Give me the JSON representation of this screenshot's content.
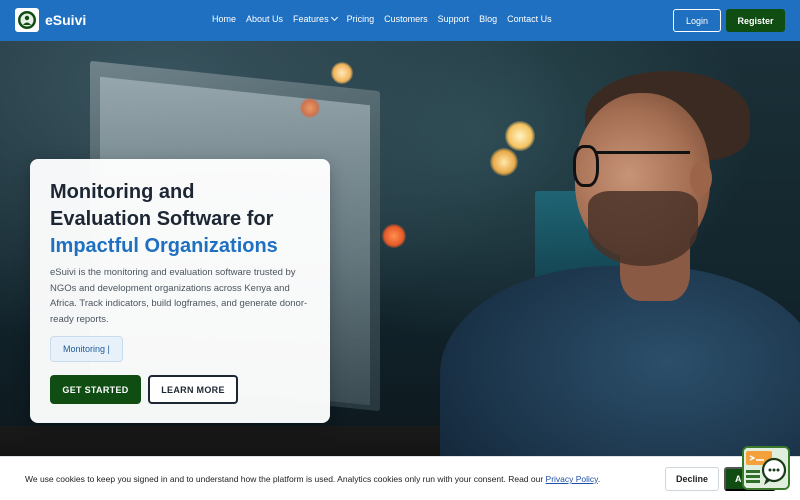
{
  "brand": {
    "name": "eSuivi"
  },
  "nav": {
    "items": [
      {
        "label": "Home"
      },
      {
        "label": "About Us"
      },
      {
        "label": "Features",
        "has_dropdown": true
      },
      {
        "label": "Pricing"
      },
      {
        "label": "Customers"
      },
      {
        "label": "Support"
      },
      {
        "label": "Blog"
      },
      {
        "label": "Contact Us"
      }
    ],
    "login_label": "Login",
    "register_label": "Register"
  },
  "hero": {
    "title_line1": "Monitoring and",
    "title_line2": "Evaluation Software for",
    "title_highlight": "Impactful Organizations",
    "description": "eSuivi is the monitoring and evaluation software trusted by NGOs and development organizations across Kenya and Africa. Track indicators, build logframes, and generate donor-ready reports.",
    "typing_text": "Monitoring |",
    "cta_primary": "GET STARTED",
    "cta_secondary": "LEARN MORE"
  },
  "cookie": {
    "text": "We use cookies to keep you signed in and to understand how the platform is used. Analytics cookies only run with your consent. Read our ",
    "link_text": "Privacy Policy",
    "suffix": ".",
    "decline_label": "Decline",
    "accept_label": "Accept"
  },
  "colors": {
    "primary": "#1f70c1",
    "cta_green": "#0f4d13",
    "heading": "#1d2733"
  },
  "icons": {
    "logo": "esuivi-logo-icon",
    "features_dropdown": "chevron-down-icon",
    "chat": "chat-widget-icon"
  }
}
